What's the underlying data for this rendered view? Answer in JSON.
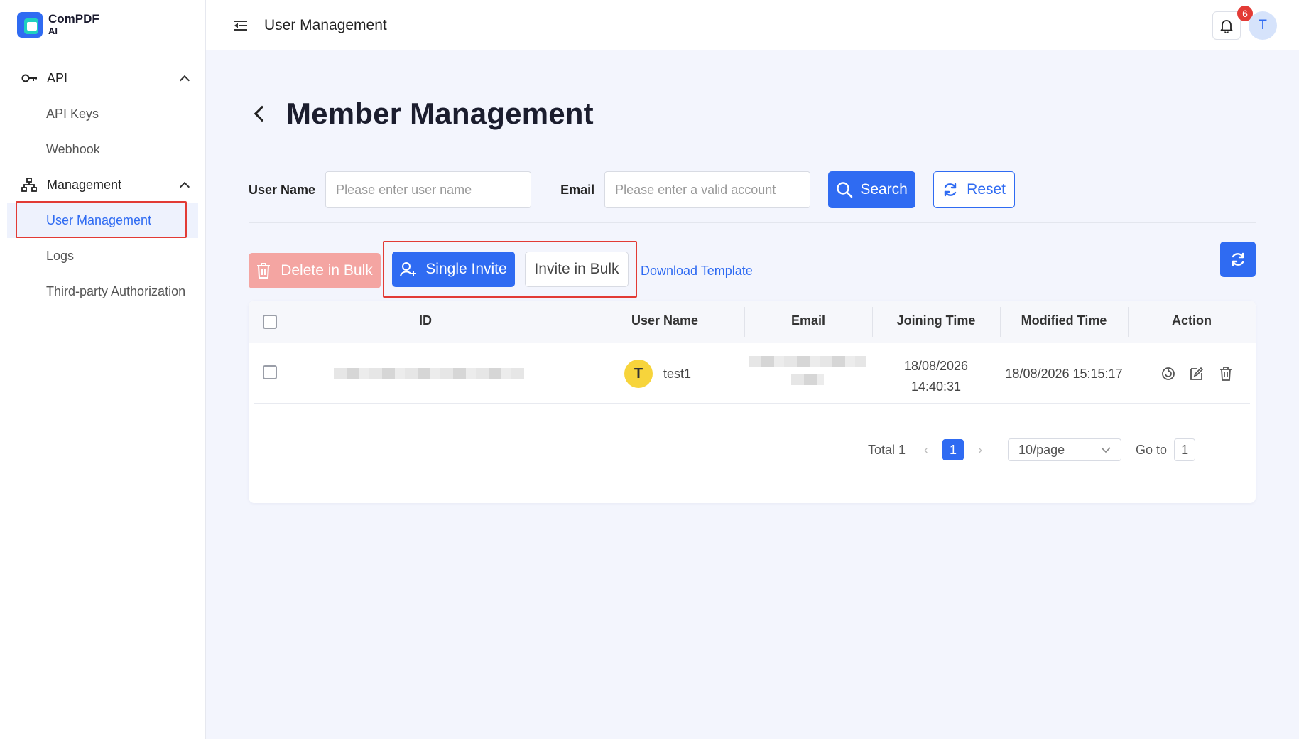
{
  "brand": {
    "name": "ComPDF",
    "sub": "AI"
  },
  "sidebar": {
    "groups": [
      {
        "label": "API",
        "items": [
          {
            "label": "API Keys"
          },
          {
            "label": "Webhook"
          }
        ]
      },
      {
        "label": "Management",
        "items": [
          {
            "label": "User Management"
          },
          {
            "label": "Logs"
          },
          {
            "label": "Third-party Authorization"
          }
        ]
      }
    ],
    "active_item": "User Management"
  },
  "topbar": {
    "title": "User Management",
    "notification_count": "6",
    "user_initial": "T"
  },
  "page": {
    "title": "Member Management"
  },
  "filters": {
    "user_name_label": "User Name",
    "user_name_placeholder": "Please enter user name",
    "email_label": "Email",
    "email_placeholder": "Please enter a valid account",
    "search_label": "Search",
    "reset_label": "Reset"
  },
  "actions": {
    "delete_bulk": "Delete in Bulk",
    "single_invite": "Single Invite",
    "invite_bulk": "Invite in Bulk",
    "download_template": "Download Template"
  },
  "table": {
    "columns": [
      "ID",
      "User Name",
      "Email",
      "Joining Time",
      "Modified Time",
      "Action"
    ],
    "rows": [
      {
        "avatar_initial": "T",
        "user_name": "test1",
        "joining_date": "18/08/2026",
        "joining_time": "14:40:31",
        "modified_time": "18/08/2026 15:15:17"
      }
    ]
  },
  "pagination": {
    "total": "Total 1",
    "current_page": "1",
    "page_size": "10/page",
    "goto_label": "Go to",
    "goto_value": "1"
  },
  "colors": {
    "primary": "#2f6bf2",
    "danger_light": "#f4a5a2",
    "highlight_border": "#e23b35",
    "avatar_yellow": "#f7d43b"
  }
}
